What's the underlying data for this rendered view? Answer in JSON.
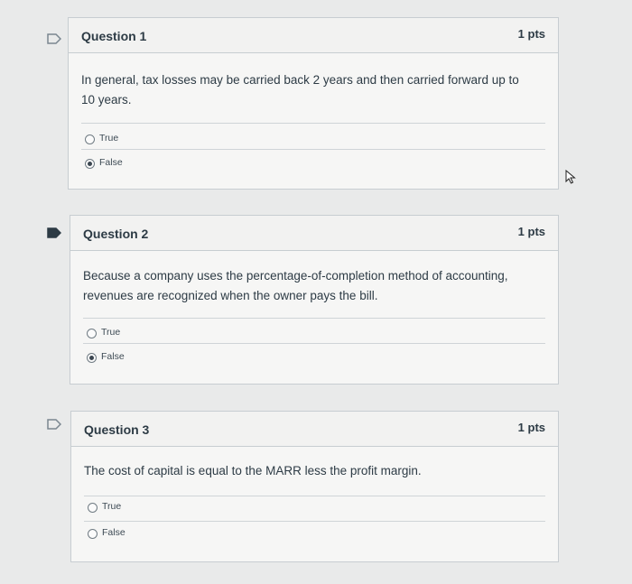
{
  "questions": [
    {
      "title": "Question 1",
      "points": "1 pts",
      "text": "In general, tax losses may be carried back 2 years and then carried forward up to 10 years.",
      "flagged": false,
      "answers": [
        {
          "label": "True",
          "selected": false
        },
        {
          "label": "False",
          "selected": true
        }
      ]
    },
    {
      "title": "Question 2",
      "points": "1 pts",
      "text": "Because a company uses the percentage-of-completion method of accounting, revenues are recognized when the owner pays the bill.",
      "flagged": true,
      "answers": [
        {
          "label": "True",
          "selected": false
        },
        {
          "label": "False",
          "selected": true
        }
      ]
    },
    {
      "title": "Question 3",
      "points": "1 pts",
      "text": "The cost of capital is equal to the MARR less the profit margin.",
      "flagged": false,
      "answers": [
        {
          "label": "True",
          "selected": false
        },
        {
          "label": "False",
          "selected": false
        }
      ]
    }
  ],
  "colors": {
    "flag_outline": "#7a8690",
    "flag_filled": "#2d3b45"
  }
}
